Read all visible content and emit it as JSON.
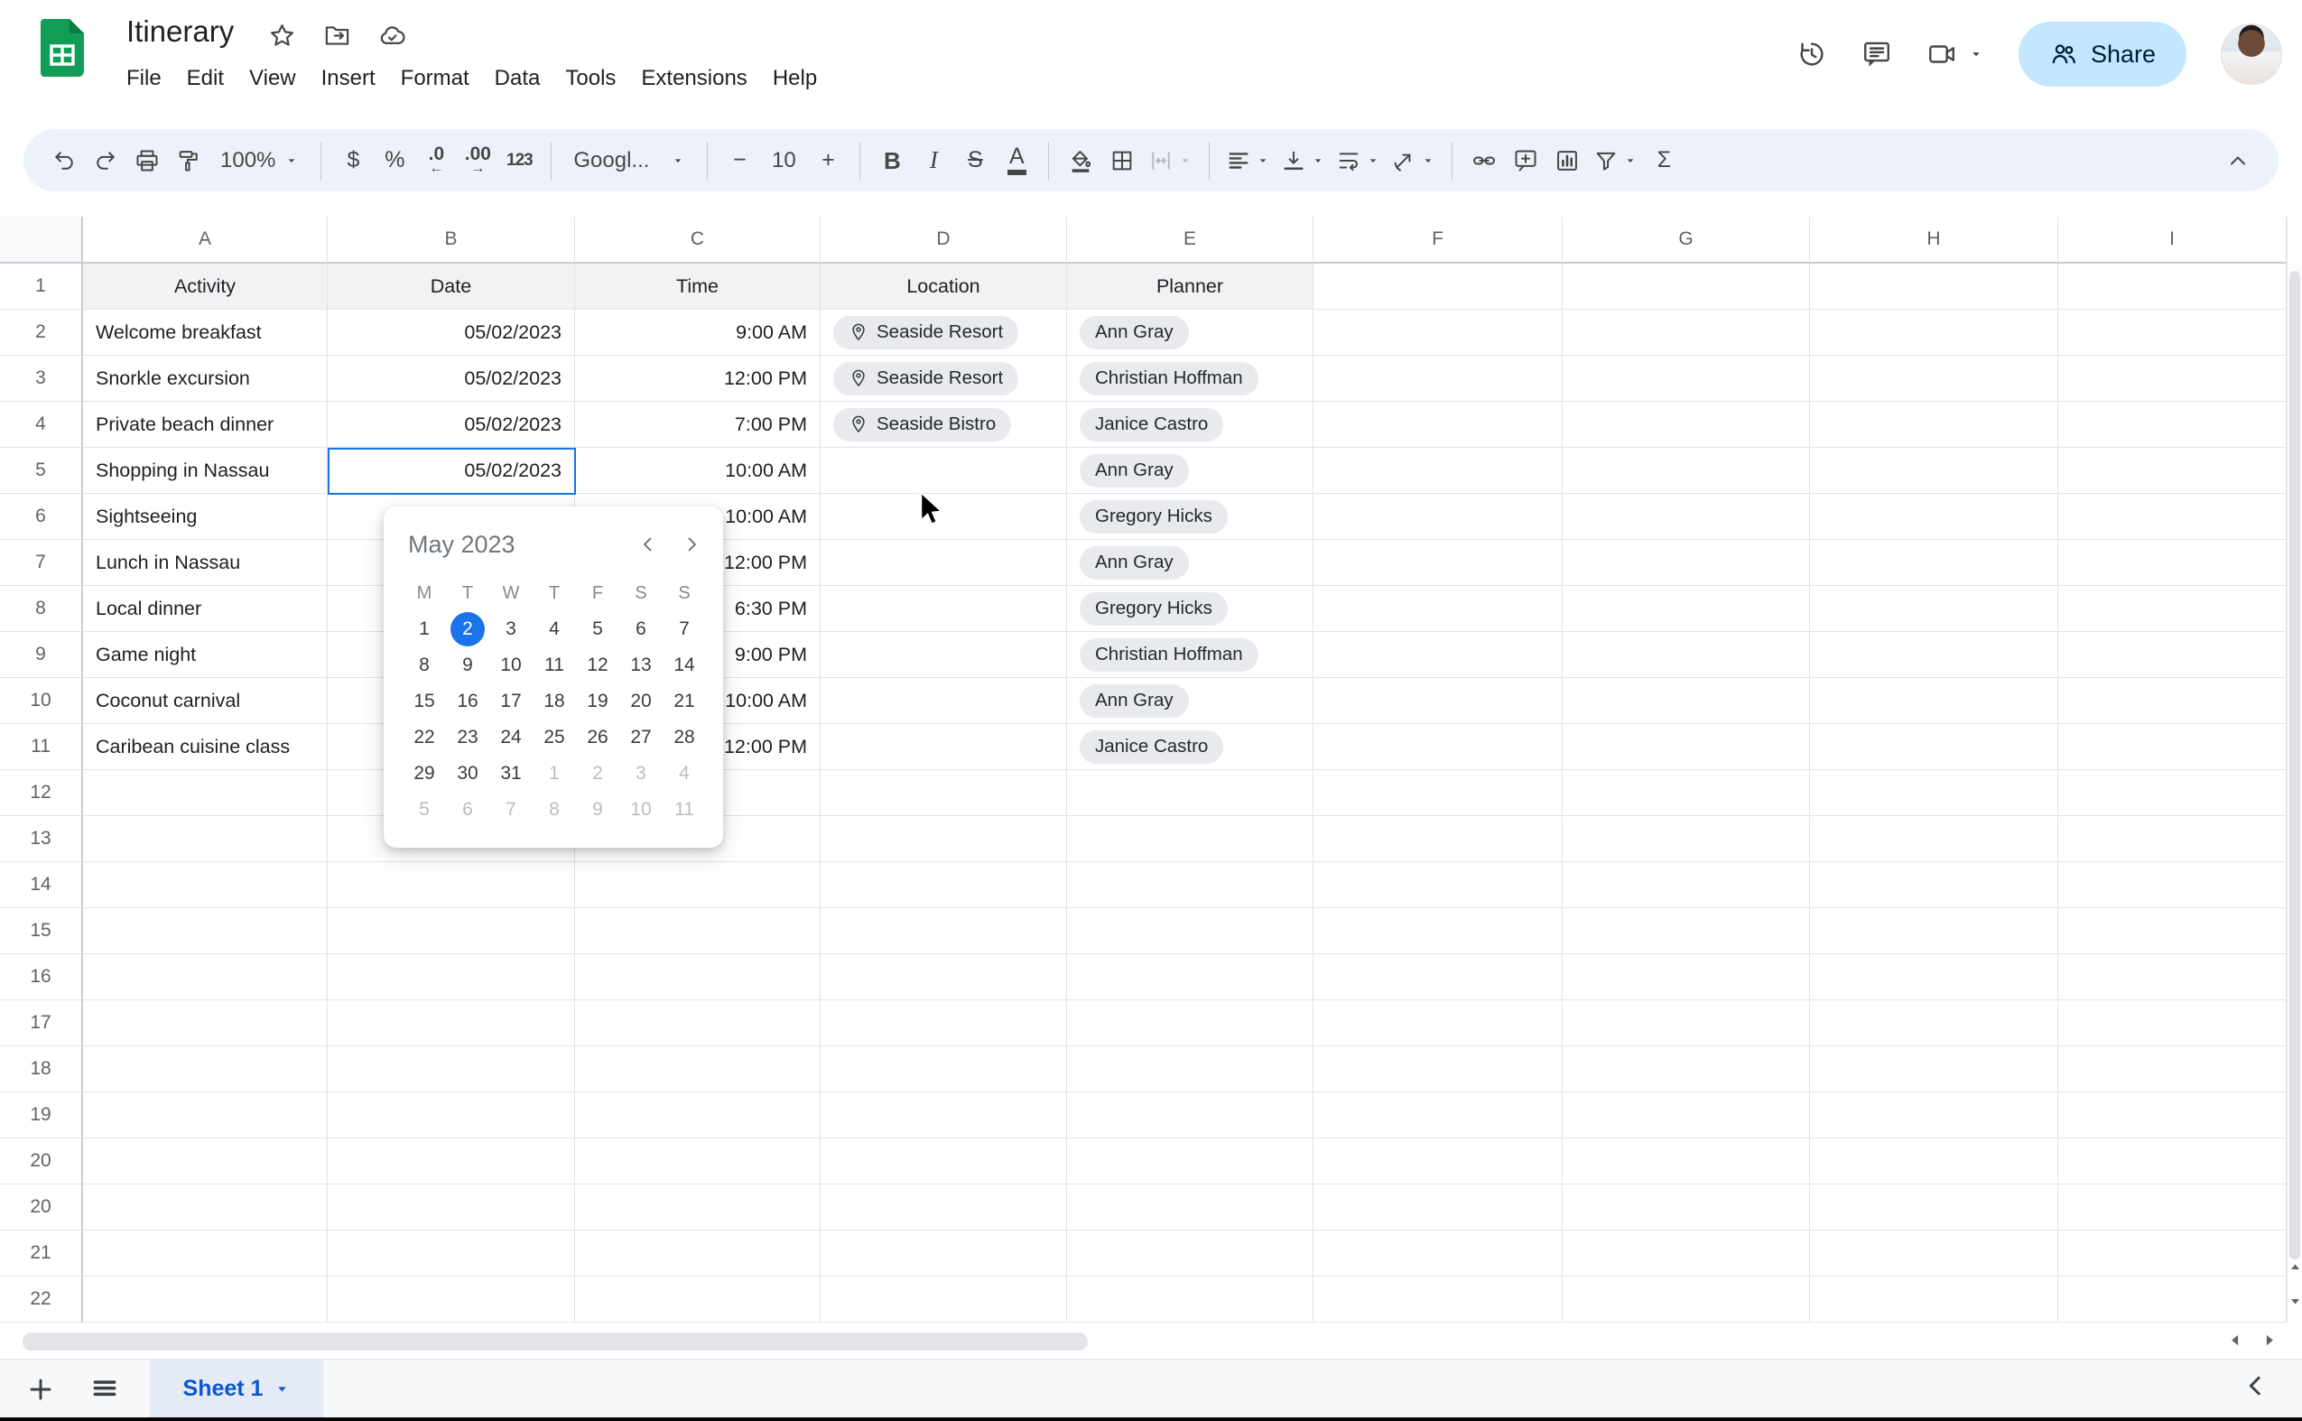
{
  "header": {
    "title": "Itinerary",
    "menu": [
      "File",
      "Edit",
      "View",
      "Insert",
      "Format",
      "Data",
      "Tools",
      "Extensions",
      "Help"
    ],
    "share_label": "Share"
  },
  "toolbar": {
    "zoom_value": "100%",
    "font_name": "Googl...",
    "font_size": "10",
    "items": [
      {
        "type": "icon",
        "name": "undo-button",
        "icon": "undo"
      },
      {
        "type": "icon",
        "name": "redo-button",
        "icon": "redo"
      },
      {
        "type": "icon",
        "name": "print-button",
        "icon": "print"
      },
      {
        "type": "icon",
        "name": "paint-format-button",
        "icon": "paint"
      },
      {
        "type": "ddtext",
        "name": "zoom-select",
        "bind": "zoom_value"
      },
      {
        "type": "sep"
      },
      {
        "type": "glyph",
        "name": "format-currency-button",
        "label": "$"
      },
      {
        "type": "glyph",
        "name": "format-percent-button",
        "label": "%"
      },
      {
        "type": "dec",
        "name": "decrease-decimal-button",
        "label": ".0",
        "arrow": "←"
      },
      {
        "type": "dec",
        "name": "increase-decimal-button",
        "label": ".00",
        "arrow": "→"
      },
      {
        "type": "glyph",
        "name": "more-formats-button",
        "label": "123",
        "cls": "g-123"
      },
      {
        "type": "sep"
      },
      {
        "type": "ddtext",
        "name": "font-select",
        "bind": "font_name",
        "w": 148
      },
      {
        "type": "sep"
      },
      {
        "type": "glyph",
        "name": "decrease-font-size-button",
        "label": "−"
      },
      {
        "type": "value",
        "name": "font-size-input",
        "bind": "font_size"
      },
      {
        "type": "glyph",
        "name": "increase-font-size-button",
        "label": "+"
      },
      {
        "type": "sep"
      },
      {
        "type": "glyph",
        "name": "bold-button",
        "label": "B",
        "cls": "g-bold"
      },
      {
        "type": "glyph",
        "name": "italic-button",
        "label": "I",
        "cls": "g-italic"
      },
      {
        "type": "glyph",
        "name": "strikethrough-button",
        "label": "S",
        "cls": "g-strike"
      },
      {
        "type": "glyph",
        "name": "text-color-button",
        "label": "A",
        "cls": "underbar"
      },
      {
        "type": "sep"
      },
      {
        "type": "icon",
        "name": "fill-color-button",
        "icon": "fill"
      },
      {
        "type": "icon",
        "name": "borders-button",
        "icon": "borders"
      },
      {
        "type": "icon",
        "name": "merge-cells-button",
        "icon": "merge",
        "dd": true,
        "disabled": true
      },
      {
        "type": "sep"
      },
      {
        "type": "icon",
        "name": "horizontal-align-button",
        "icon": "halign",
        "dd": true
      },
      {
        "type": "icon",
        "name": "vertical-align-button",
        "icon": "valign",
        "dd": true
      },
      {
        "type": "icon",
        "name": "text-wrap-button",
        "icon": "wrap",
        "dd": true
      },
      {
        "type": "icon",
        "name": "text-rotation-button",
        "icon": "rotate",
        "dd": true
      },
      {
        "type": "sep"
      },
      {
        "type": "icon",
        "name": "insert-link-button",
        "icon": "link"
      },
      {
        "type": "icon",
        "name": "insert-comment-button",
        "icon": "comment-add"
      },
      {
        "type": "icon",
        "name": "insert-chart-button",
        "icon": "chart"
      },
      {
        "type": "icon",
        "name": "create-filter-button",
        "icon": "filter",
        "dd": true
      },
      {
        "type": "glyph",
        "name": "functions-button",
        "label": "Σ"
      }
    ]
  },
  "grid": {
    "column_letters": [
      "A",
      "B",
      "C",
      "D",
      "E",
      "F",
      "G",
      "H",
      "I"
    ],
    "header_row": [
      "Activity",
      "Date",
      "Time",
      "Location",
      "Planner"
    ],
    "rows": [
      {
        "label": "1",
        "type": "header"
      },
      {
        "label": "2",
        "cells": [
          "Welcome breakfast",
          "05/02/2023",
          "9:00 AM",
          "Seaside Resort",
          "Ann Gray"
        ]
      },
      {
        "label": "3",
        "cells": [
          "Snorkle excursion",
          "05/02/2023",
          "12:00 PM",
          "Seaside Resort",
          "Christian Hoffman"
        ]
      },
      {
        "label": "4",
        "cells": [
          "Private beach dinner",
          "05/02/2023",
          "7:00 PM",
          "Seaside Bistro",
          "Janice Castro"
        ]
      },
      {
        "label": "5",
        "cells": [
          "Shopping in Nassau",
          "05/02/2023",
          "10:00 AM",
          "",
          "Ann Gray"
        ]
      },
      {
        "label": "6",
        "cells": [
          "Sightseeing",
          "",
          "10:00 AM",
          "",
          "Gregory Hicks"
        ]
      },
      {
        "label": "7",
        "cells": [
          "Lunch in Nassau",
          "",
          "12:00 PM",
          "",
          "Ann Gray"
        ]
      },
      {
        "label": "8",
        "cells": [
          "Local dinner",
          "",
          "6:30 PM",
          "",
          "Gregory Hicks"
        ]
      },
      {
        "label": "9",
        "cells": [
          "Game night",
          "",
          "9:00 PM",
          "",
          "Christian Hoffman"
        ]
      },
      {
        "label": "10",
        "cells": [
          "Coconut carnival",
          "",
          "10:00 AM",
          "",
          "Ann Gray"
        ]
      },
      {
        "label": "11",
        "cells": [
          "Caribean cuisine class",
          "",
          "12:00 PM",
          "",
          "Janice Castro"
        ]
      },
      {
        "label": "12"
      },
      {
        "label": "13"
      },
      {
        "label": "14"
      },
      {
        "label": "15"
      },
      {
        "label": "16"
      },
      {
        "label": "17"
      },
      {
        "label": "18"
      },
      {
        "label": "19"
      },
      {
        "label": "20"
      },
      {
        "label": "20"
      },
      {
        "label": "21"
      },
      {
        "label": "22"
      }
    ],
    "selected_cell": "B5"
  },
  "calendar": {
    "title": "May 2023",
    "day_headers": [
      "M",
      "T",
      "W",
      "T",
      "F",
      "S",
      "S"
    ],
    "weeks": [
      [
        {
          "d": "1"
        },
        {
          "d": "2",
          "selected": true
        },
        {
          "d": "3"
        },
        {
          "d": "4"
        },
        {
          "d": "5"
        },
        {
          "d": "6"
        },
        {
          "d": "7"
        }
      ],
      [
        {
          "d": "8"
        },
        {
          "d": "9"
        },
        {
          "d": "10"
        },
        {
          "d": "11"
        },
        {
          "d": "12"
        },
        {
          "d": "13"
        },
        {
          "d": "14"
        }
      ],
      [
        {
          "d": "15"
        },
        {
          "d": "16"
        },
        {
          "d": "17"
        },
        {
          "d": "18"
        },
        {
          "d": "19"
        },
        {
          "d": "20"
        },
        {
          "d": "21"
        }
      ],
      [
        {
          "d": "22"
        },
        {
          "d": "23"
        },
        {
          "d": "24"
        },
        {
          "d": "25"
        },
        {
          "d": "26"
        },
        {
          "d": "27"
        },
        {
          "d": "28"
        }
      ],
      [
        {
          "d": "29"
        },
        {
          "d": "30"
        },
        {
          "d": "31"
        },
        {
          "d": "1",
          "muted": true
        },
        {
          "d": "2",
          "muted": true
        },
        {
          "d": "3",
          "muted": true
        },
        {
          "d": "4",
          "muted": true
        }
      ],
      [
        {
          "d": "5",
          "muted": true
        },
        {
          "d": "6",
          "muted": true
        },
        {
          "d": "7",
          "muted": true
        },
        {
          "d": "8",
          "muted": true
        },
        {
          "d": "9",
          "muted": true
        },
        {
          "d": "10",
          "muted": true
        },
        {
          "d": "11",
          "muted": true
        }
      ]
    ]
  },
  "bottombar": {
    "sheet_name": "Sheet 1"
  },
  "colors": {
    "accent_blue": "#1a73e8",
    "share_bg": "#c2e7ff",
    "share_text": "#001d35",
    "toolbar_bg": "#edf2fa",
    "chip_bg": "#e9eaed",
    "sheet_tab_text": "#0b57d0",
    "logo_green": "#0f9d58",
    "header_row_bg": "#f1f2f3"
  }
}
